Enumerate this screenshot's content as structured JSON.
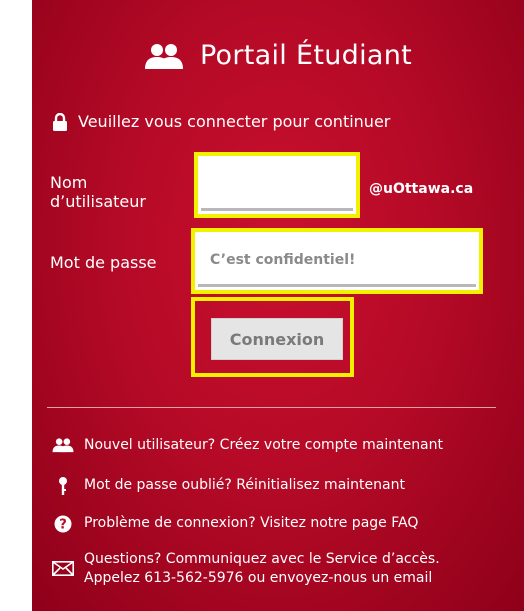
{
  "header": {
    "title": "Portail Étudiant",
    "icon": "users-icon"
  },
  "subtitle": {
    "text": "Veuillez vous connecter pour continuer",
    "icon": "lock-icon"
  },
  "username": {
    "label_line1": "Nom",
    "label_line2": "d’utilisateur",
    "value": "",
    "placeholder": "",
    "suffix": "@uOttawa.ca"
  },
  "password": {
    "label": "Mot de passe",
    "placeholder": "C’est confidentiel!"
  },
  "submit": {
    "label": "Connexion"
  },
  "links": [
    {
      "icon": "users-icon",
      "text": "Nouvel utilisateur? Créez votre compte maintenant"
    },
    {
      "icon": "key-icon",
      "text": "Mot de passe oublié? Réinitialisez maintenant"
    },
    {
      "icon": "question-icon",
      "text": "Problème de connexion? Visitez notre page FAQ"
    },
    {
      "icon": "envelope-icon",
      "line1": "Questions? Communiquez avec le Service d’accès.",
      "line2": "Appelez 613-562-5976 ou envoyez-nous un email"
    }
  ],
  "colors": {
    "panel": "#c8102e",
    "highlight": "#f2f200"
  }
}
